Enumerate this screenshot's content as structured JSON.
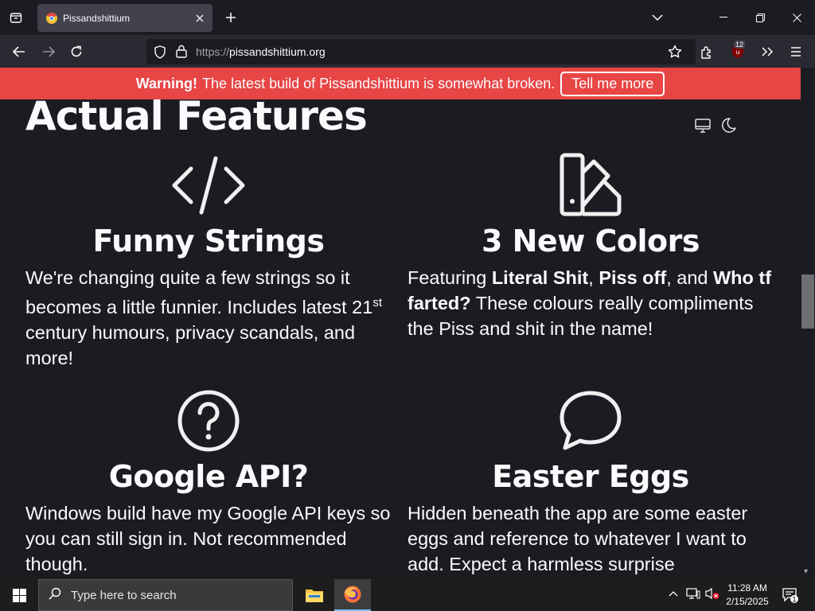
{
  "browser": {
    "tab_title": "Pissandshittium",
    "url_scheme": "https://",
    "url_host": "pissandshittium.org",
    "extension_badge": "12"
  },
  "banner": {
    "warning_label": "Warning!",
    "warning_text": "The latest build of Pissandshittium is somewhat broken.",
    "button_label": "Tell me more"
  },
  "page": {
    "heading": "Actual Features",
    "features": [
      {
        "icon": "code-icon",
        "title": "Funny Strings",
        "text_a": "We're changing quite a few strings so it becomes a little funnier. Includes latest 21",
        "text_sup": "st",
        "text_b": " century humours, privacy scandals, and more!"
      },
      {
        "icon": "swatch-icon",
        "title": "3 New Colors",
        "text_intro": "Featuring ",
        "color_1": "Literal Shit",
        "sep_1": ", ",
        "color_2": "Piss off",
        "sep_2": ", and ",
        "color_3": "Who tf farted?",
        "text_outro": " These colours really compliments the Piss and shit in the name!"
      },
      {
        "icon": "question-icon",
        "title": "Google API?",
        "text": "Windows build have my Google API keys so you can still sign in. Not recommended though."
      },
      {
        "icon": "speech-bubble-icon",
        "title": "Easter Eggs",
        "text": "Hidden beneath the app are some easter eggs and reference to whatever I want to add. Expect a harmless surprise"
      }
    ]
  },
  "taskbar": {
    "search_placeholder": "Type here to search",
    "time": "11:28 AM",
    "date": "2/15/2025",
    "notification_count": "1"
  },
  "colors": {
    "banner_bg": "#e84545",
    "page_bg": "#1c1b22",
    "toolbar_bg": "#2b2a33"
  }
}
